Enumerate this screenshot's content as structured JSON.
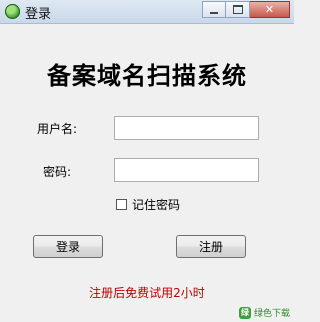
{
  "window": {
    "title": "登录",
    "controls": {
      "minimize": "",
      "maximize": "",
      "close": "✕"
    }
  },
  "main": {
    "heading": "备案域名扫描系统",
    "username_label": "用户名:",
    "username_value": "",
    "password_label": "密码:",
    "password_value": "",
    "remember_label": "记住密码",
    "remember_checked": false,
    "login_button": "登录",
    "register_button": "注册",
    "trial_notice": "注册后免费试用2小时"
  },
  "watermark": {
    "icon_glyph": "绿",
    "text": "绿色下载"
  },
  "colors": {
    "notice": "#c00000",
    "titlebar": "#c9d8ea"
  }
}
